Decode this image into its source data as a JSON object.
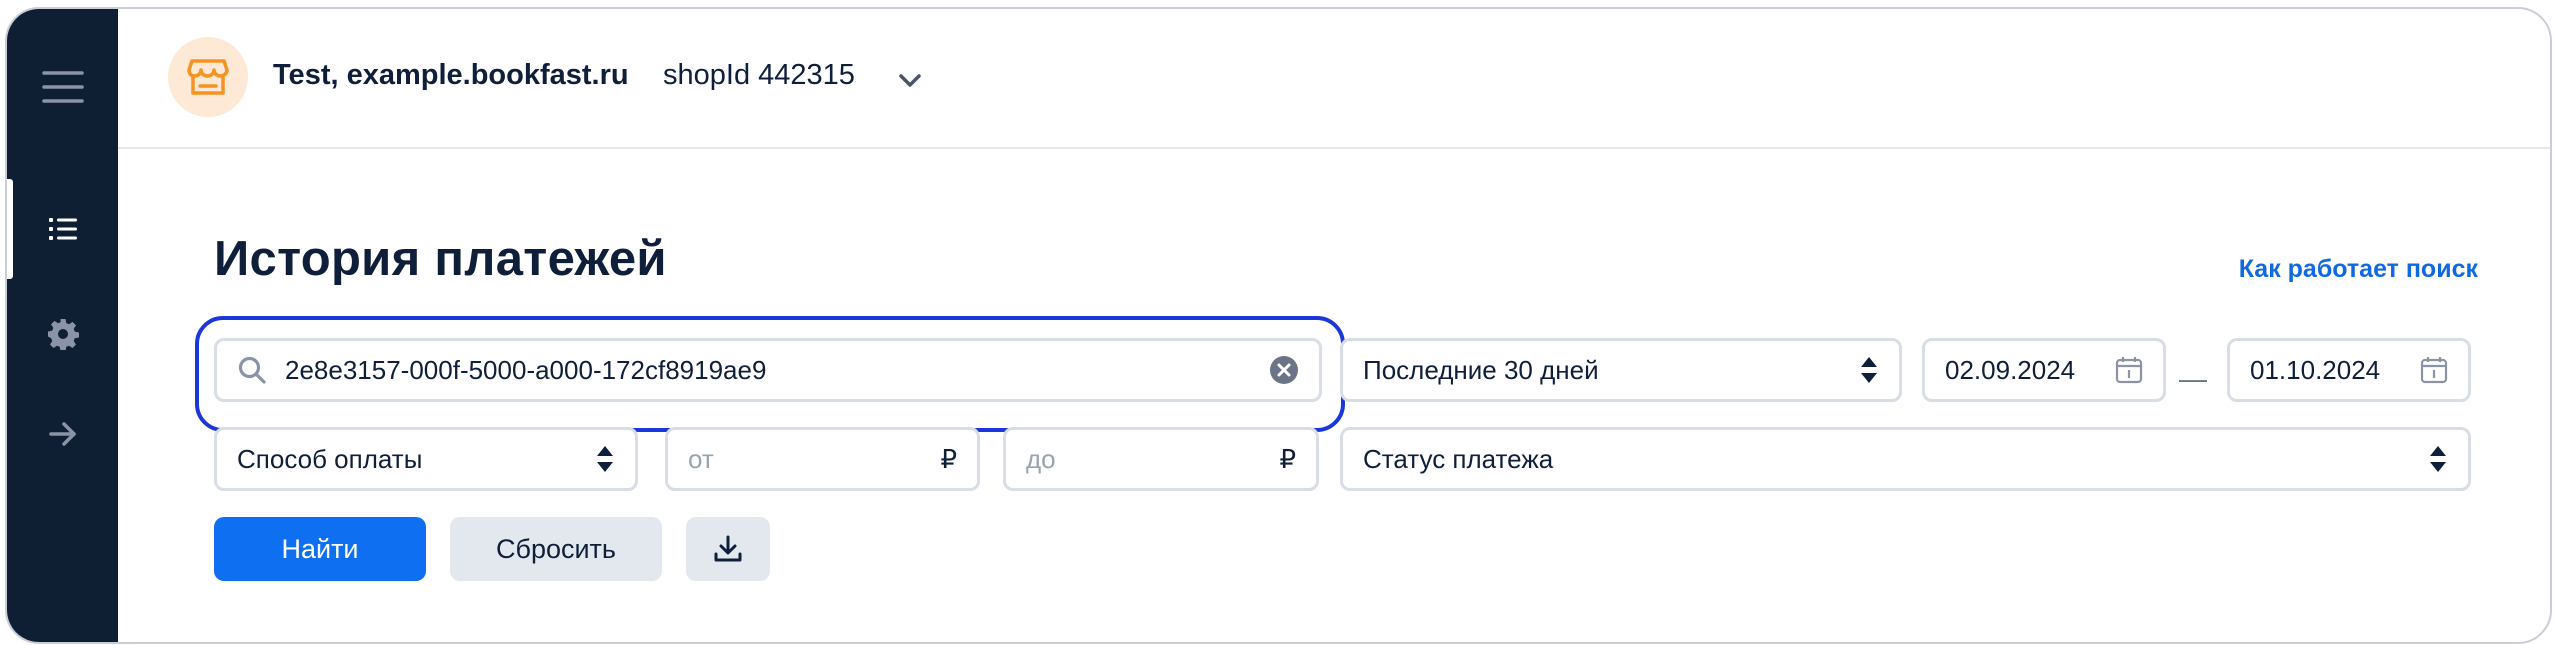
{
  "sidebar": {
    "items": [
      {
        "icon": "menu-icon"
      },
      {
        "icon": "list-icon",
        "active": true
      },
      {
        "icon": "gear-icon"
      },
      {
        "icon": "arrow-right-icon"
      }
    ]
  },
  "header": {
    "shop_icon": "store-icon",
    "shop_name": "Test, example.bookfast.ru",
    "shop_id": "shopId 442315",
    "chevron_icon": "chevron-down-icon"
  },
  "main": {
    "title": "История платежей",
    "help_link": "Как работает поиск",
    "search": {
      "value": "2e8e3157-000f-5000-a000-172cf8919ae9",
      "icon": "search-icon",
      "clear_icon": "clear-icon"
    },
    "period_select": "Последние 30 дней",
    "date_from": "02.09.2024",
    "date_separator": "—",
    "date_to": "01.10.2024",
    "payment_method_select": "Способ оплаты",
    "amount_from_placeholder": "от",
    "amount_to_placeholder": "до",
    "currency_symbol": "₽",
    "status_select": "Статус платежа",
    "find_button": "Найти",
    "reset_button": "Сбросить",
    "download_icon": "download-icon"
  },
  "colors": {
    "sidebar_bg": "#0f1f33",
    "accent": "#0e6ff0",
    "focus_ring": "#1b37d9",
    "shop_icon": "#f59324"
  }
}
